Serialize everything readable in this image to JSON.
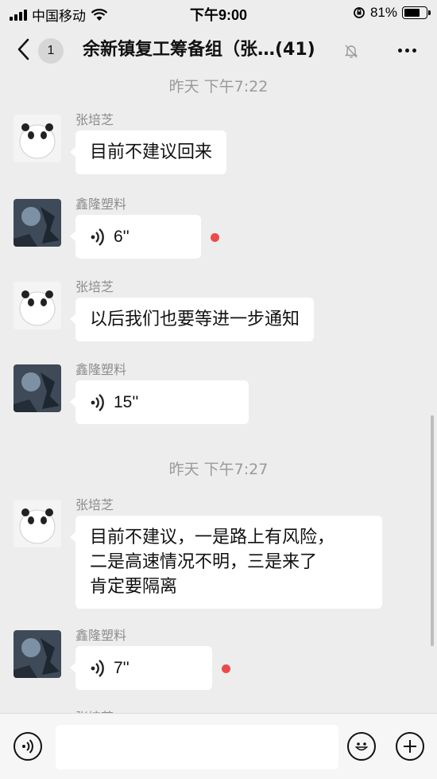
{
  "status_bar": {
    "carrier": "中国移动",
    "time": "下午9:00",
    "battery": "81%",
    "battery_level": 0.81
  },
  "nav": {
    "unread_count": "1",
    "title": "余新镇复工筹备组（张…(41)"
  },
  "messages": [
    {
      "type": "time",
      "text": "昨天 下午7:22"
    },
    {
      "type": "text",
      "sender": "张培芝",
      "avatar": "panda",
      "text": "目前不建议回来"
    },
    {
      "type": "voice",
      "sender": "鑫隆塑料",
      "avatar": "night-scene",
      "duration": "6''",
      "unread": true
    },
    {
      "type": "text",
      "sender": "张培芝",
      "avatar": "panda",
      "text": "以后我们也要等进一步通知"
    },
    {
      "type": "voice",
      "sender": "鑫隆塑料",
      "avatar": "night-scene",
      "duration": "15''",
      "unread": false
    },
    {
      "type": "time",
      "text": "昨天 下午7:27"
    },
    {
      "type": "text",
      "sender": "张培芝",
      "avatar": "panda",
      "lines": [
        "目前不建议，一是路上有风险，",
        "二是高速情况不明，三是来了",
        "肯定要隔离"
      ]
    },
    {
      "type": "voice",
      "sender": "鑫隆塑料",
      "avatar": "night-scene",
      "duration": "7''",
      "unread": true
    }
  ],
  "partial_sender": "张培芝",
  "input_bar": {
    "voice_icon": "voice-mode-icon",
    "emoji_icon": "emoji-icon",
    "plus_icon": "plus-icon"
  },
  "colors": {
    "background": "#ededed",
    "bubble": "#ffffff",
    "unread_dot": "#ec4a4a",
    "timestamp": "#9a9a9a"
  }
}
